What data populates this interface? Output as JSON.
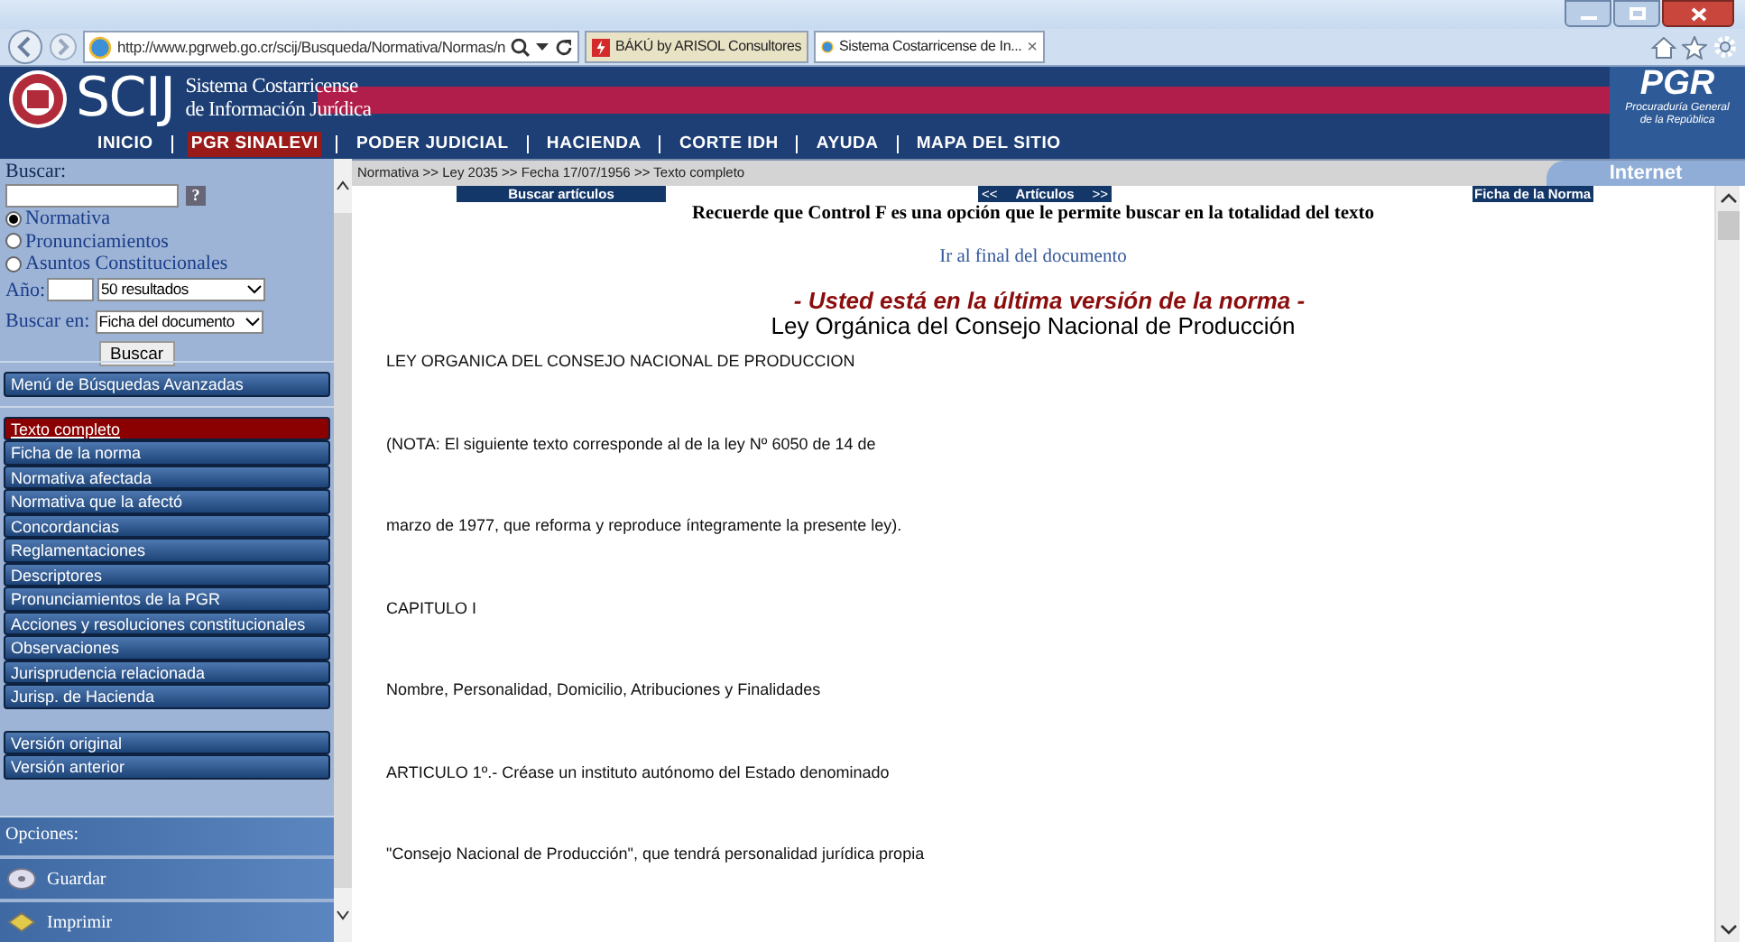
{
  "browser": {
    "address": "http://www.pgrweb.go.cr/scij/Busqueda/Normativa/Normas/n",
    "tabs": [
      {
        "label": "BÁKÚ by ARISOL Consultores",
        "selected": false
      },
      {
        "label": "Sistema Costarricense de In...",
        "selected": true,
        "close": "×"
      }
    ]
  },
  "header": {
    "logo": "SCIJ",
    "title_lines": [
      "Sistema Costarricense",
      "de Información Jurídica"
    ],
    "brand": "PGR",
    "brand_lines": [
      "Procuraduría General",
      "de la República"
    ]
  },
  "nav": [
    {
      "label": "INICIO",
      "selected": false
    },
    {
      "label": "PGR SINALEVI",
      "selected": true
    },
    {
      "label": "PODER JUDICIAL",
      "selected": false
    },
    {
      "label": "HACIENDA",
      "selected": false
    },
    {
      "label": "CORTE IDH",
      "selected": false
    },
    {
      "label": "AYUDA",
      "selected": false
    },
    {
      "label": "MAPA DEL SITIO",
      "selected": false
    }
  ],
  "breadcrumb": "Normativa >> Ley 2035 >> Fecha 17/07/1956 >> Texto completo",
  "zone": "Internet",
  "search": {
    "label": "Buscar:",
    "help": "?",
    "scopes": [
      {
        "label": "Normativa",
        "selected": true
      },
      {
        "label": "Pronunciamientos",
        "selected": false
      },
      {
        "label": "Asuntos Constitucionales",
        "selected": false
      }
    ],
    "year_label": "Año:",
    "results": "50 resultados",
    "where_label": "Buscar en:",
    "where": "Ficha del documento",
    "button": "Buscar"
  },
  "advanced": "Menú de Búsquedas Avanzadas",
  "menu": [
    {
      "label": "Texto completo",
      "selected": true
    },
    {
      "label": "Ficha de la norma",
      "selected": false
    },
    {
      "label": "Normativa afectada",
      "selected": false
    },
    {
      "label": "Normativa que la afectó",
      "selected": false
    },
    {
      "label": "Concordancias",
      "selected": false
    },
    {
      "label": "Reglamentaciones",
      "selected": false
    },
    {
      "label": "Descriptores",
      "selected": false
    },
    {
      "label": "Pronunciamientos de la PGR",
      "selected": false
    },
    {
      "label": "Acciones y resoluciones constitucionales",
      "selected": false
    },
    {
      "label": "Observaciones",
      "selected": false
    },
    {
      "label": "Jurisprudencia relacionada",
      "selected": false
    },
    {
      "label": "Jurisp. de Hacienda",
      "selected": false
    }
  ],
  "versions": [
    "Versión original",
    "Versión anterior"
  ],
  "options": {
    "label": "Opciones:",
    "items": [
      {
        "kind": "save",
        "label": "Guardar"
      },
      {
        "kind": "print",
        "label": "Imprimir"
      }
    ]
  },
  "toolbar": {
    "search_articles": "Buscar artículos",
    "prev": "<<",
    "articles": "Artículos",
    "next": ">>",
    "sheet": "Ficha de la Norma"
  },
  "notice": "Recuerde que Control F es una opción que le permite buscar en la totalidad del texto",
  "end_link": "Ir al final del documento",
  "version_notice": "- Usted está en la última versión de la norma -",
  "title": "Ley Orgánica del Consejo Nacional de Producción",
  "paragraphs": [
    "LEY ORGANICA DEL CONSEJO NACIONAL DE PRODUCCION",
    "(NOTA: El siguiente texto corresponde al de la ley Nº 6050 de 14 de",
    "marzo de 1977, que reforma y reproduce íntegramente la presente ley).",
    "CAPITULO I",
    "Nombre, Personalidad, Domicilio, Atribuciones y Finalidades",
    "ARTICULO 1º.- Créase un instituto autónomo del Estado denominado",
    "\"Consejo Nacional de Producción\", que tendrá personalidad jurídica propia"
  ]
}
